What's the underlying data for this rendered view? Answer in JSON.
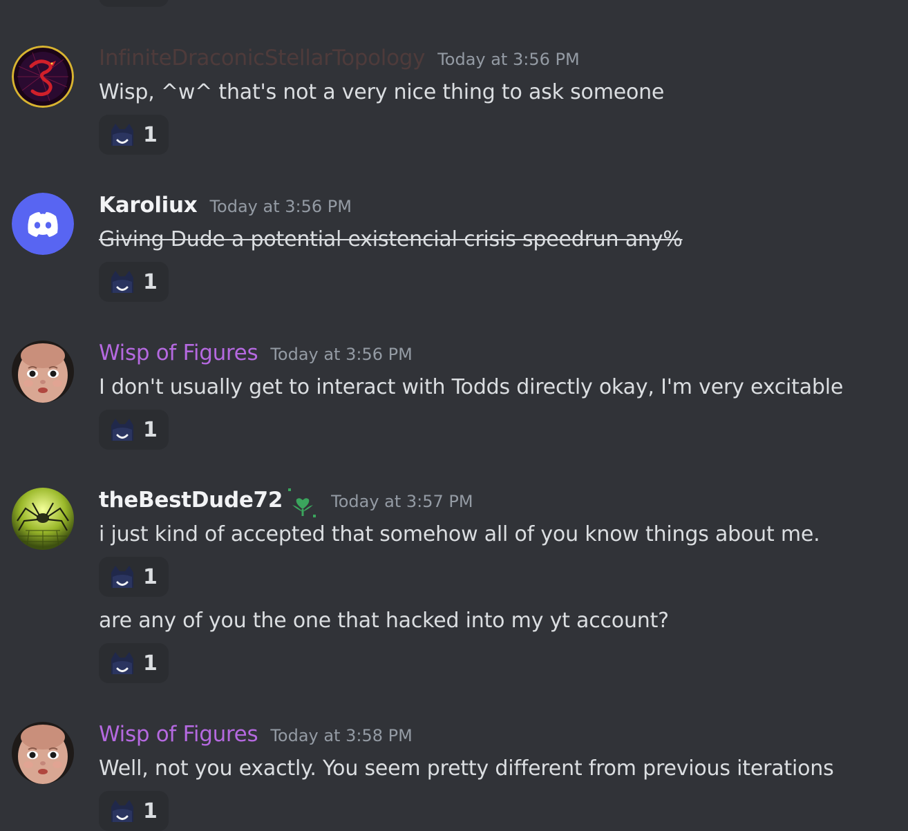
{
  "messages": [
    {
      "username": "InfiniteDraconicStellarTopology",
      "username_color": "#4e3b3b",
      "timestamp": "Today at 3:56 PM",
      "avatar_icon": "dragon-avatar",
      "content": "Wisp, ^w^ that's not a very nice thing to ask someone",
      "reaction": {
        "emoji": "cat-face-emoji",
        "count": "1"
      }
    },
    {
      "username": "Karoliux",
      "username_color": "#f2f3f5",
      "timestamp": "Today at 3:56 PM",
      "avatar_icon": "discord-default-avatar",
      "content": "Giving Dude a potential existencial crisis speedrun any%",
      "strikethrough": true,
      "reaction": {
        "emoji": "cat-face-emoji",
        "count": "1"
      }
    },
    {
      "username": "Wisp of Figures",
      "username_color": "#b569e0",
      "timestamp": "Today at 3:56 PM",
      "avatar_icon": "doll-face-avatar",
      "content": "I don't usually get to interact with Todds directly okay, I'm very excitable",
      "reaction": {
        "emoji": "cat-face-emoji",
        "count": "1"
      }
    },
    {
      "username": "theBestDude72",
      "username_color": "#f2f3f5",
      "timestamp": "Today at 3:57 PM",
      "avatar_icon": "spider-avatar",
      "badge_icon": "heart-plant-badge-icon",
      "content": "i just kind of accepted that somehow all of you know things about me.",
      "reaction": {
        "emoji": "cat-face-emoji",
        "count": "1"
      },
      "followup": {
        "content": "are any of you the one that hacked into my yt account?",
        "reaction": {
          "emoji": "cat-face-emoji",
          "count": "1"
        }
      }
    },
    {
      "username": "Wisp of Figures",
      "username_color": "#b569e0",
      "timestamp": "Today at 3:58 PM",
      "avatar_icon": "doll-face-avatar",
      "content": "Well, not you exactly. You seem pretty different from previous iterations",
      "reaction": {
        "emoji": "cat-face-emoji",
        "count": "1"
      }
    }
  ]
}
